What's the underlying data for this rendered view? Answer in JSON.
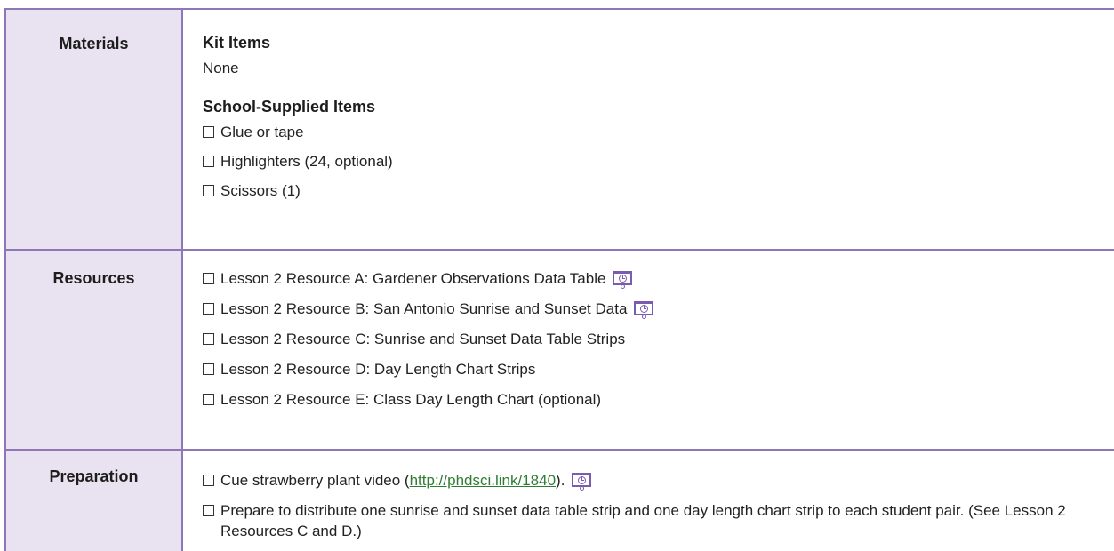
{
  "colors": {
    "border": "#8e76b8",
    "label_background": "#e9e3f1",
    "link": "#2f7d32",
    "icon": "#7a5bb0"
  },
  "materials": {
    "label": "Materials",
    "kit_heading": "Kit Items",
    "kit_text": "None",
    "school_heading": "School-Supplied Items",
    "items": [
      {
        "text": "Glue or tape"
      },
      {
        "text": "Highlighters (24, optional)"
      },
      {
        "text": "Scissors (1)"
      }
    ]
  },
  "resources": {
    "label": "Resources",
    "items": [
      {
        "text": "Lesson 2 Resource A: Gardener Observations Data Table",
        "icon": "projector-icon"
      },
      {
        "text": "Lesson 2 Resource B: San Antonio Sunrise and Sunset Data",
        "icon": "projector-icon"
      },
      {
        "text": "Lesson 2 Resource C: Sunrise and Sunset Data Table Strips"
      },
      {
        "text": "Lesson 2 Resource D: Day Length Chart Strips"
      },
      {
        "text": "Lesson 2 Resource E: Class Day Length Chart (optional)"
      }
    ]
  },
  "preparation": {
    "label": "Preparation",
    "items": [
      {
        "text_before": "Cue strawberry plant video (",
        "link_text": "http://phdsci.link/1840",
        "text_after": ").",
        "icon": "projector-icon"
      },
      {
        "text": "Prepare to distribute one sunrise and sunset data table strip and one day length chart strip to each student pair. (See Lesson 2 Resources C and D.)"
      }
    ]
  }
}
